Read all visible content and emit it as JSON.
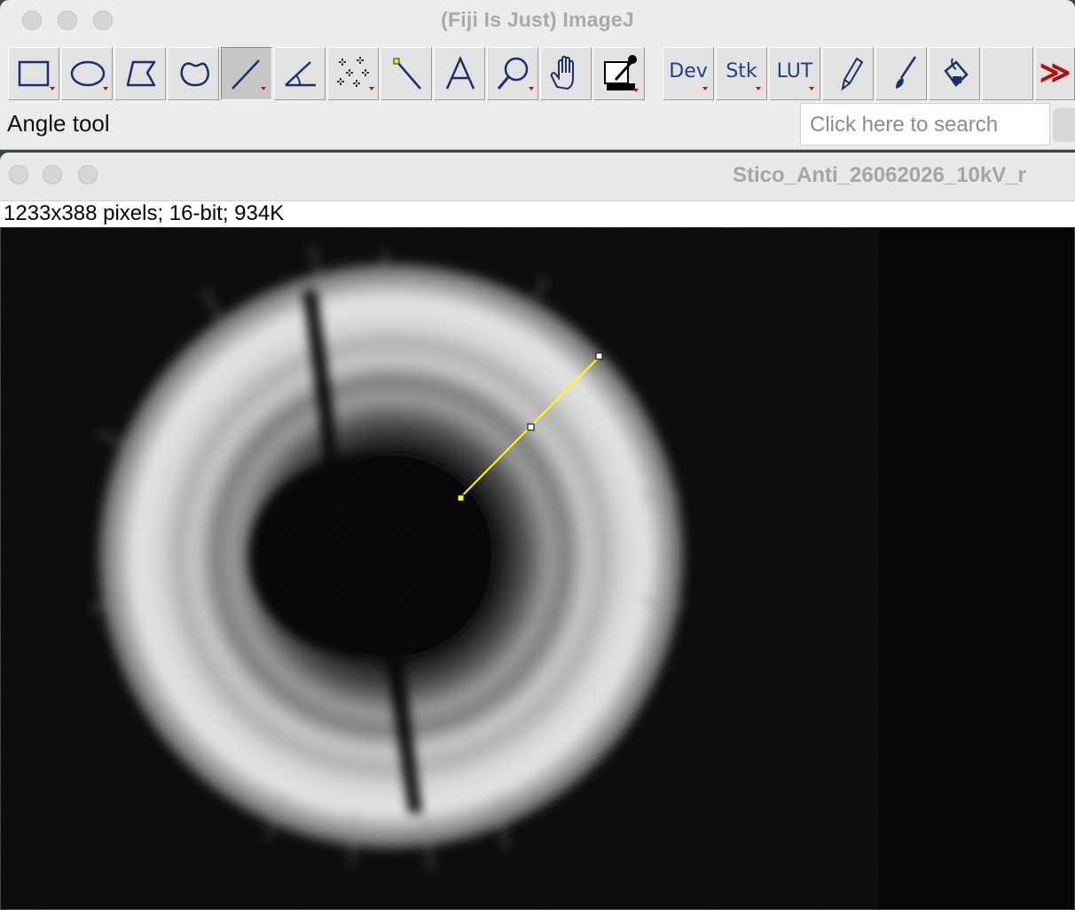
{
  "main_window": {
    "title": "(Fiji Is Just) ImageJ",
    "status_text": "Angle tool",
    "search_placeholder": "Click here to search"
  },
  "toolbar": {
    "tools": [
      {
        "name": "rectangle-tool",
        "icon": "rectangle-icon",
        "selected": false
      },
      {
        "name": "oval-tool",
        "icon": "oval-icon",
        "selected": false
      },
      {
        "name": "polygon-tool",
        "icon": "polygon-icon",
        "selected": false
      },
      {
        "name": "freehand-tool",
        "icon": "freehand-icon",
        "selected": false
      },
      {
        "name": "line-tool",
        "icon": "line-icon",
        "selected": true
      },
      {
        "name": "angle-tool",
        "icon": "angle-icon",
        "selected": false
      },
      {
        "name": "point-tool",
        "icon": "multipoint-icon",
        "selected": false
      },
      {
        "name": "wand-tool",
        "icon": "wand-icon",
        "selected": false
      },
      {
        "name": "text-tool",
        "icon": "text-a-icon",
        "selected": false
      },
      {
        "name": "zoom-tool",
        "icon": "magnifier-icon",
        "selected": false
      },
      {
        "name": "hand-tool",
        "icon": "hand-icon",
        "selected": false
      },
      {
        "name": "color-picker-tool",
        "icon": "dropper-icon",
        "selected": false
      }
    ],
    "menus": {
      "dev": "Dev",
      "stk": "Stk",
      "lut": "LUT"
    },
    "extra_tools": [
      {
        "name": "pencil-tool",
        "icon": "pencil-icon"
      },
      {
        "name": "brush-tool",
        "icon": "brush-icon"
      },
      {
        "name": "flood-fill-tool",
        "icon": "paint-bucket-icon"
      }
    ],
    "more_label": "≫"
  },
  "image_window": {
    "title": "Stico_Anti_26062026_10kV_r",
    "info": "1233x388 pixels; 16-bit; 934K"
  },
  "overlay": {
    "line_color": "#ffff00"
  }
}
